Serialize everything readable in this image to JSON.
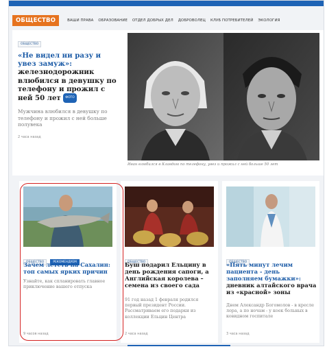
{
  "nav": {
    "section": "ОБЩЕСТВО",
    "items": [
      "ВАШИ ПРАВА",
      "ОБРАЗОВАНИЕ",
      "ОТДЕЛ ДОБРЫХ ДЕЛ",
      "ДОБРОВОЛЕЦ",
      "КЛУБ ПОТРЕБИТЕЛЕЙ",
      "ЭКОЛОГИЯ"
    ]
  },
  "hero": {
    "badge": "ОБЩЕСТВО",
    "title_quote": "«Не видел ни разу и увез замуж»:",
    "title_rest": "железнодорожник влюбился в девушку по телефону и прожил с ней 50 лет",
    "photo_tag": "ФОТО",
    "lead": "Мужчина влюбился в девушку по телефону и прожил с ней больше полувека",
    "time": "2 часа назад",
    "caption": "Иван влюбился в Клавдию по телефону, увез и прожил с ней больше 50 лет"
  },
  "cards": [
    {
      "badges": [
        "ОБЩЕСТВО",
        "РЕКОМЕНДУЕМ"
      ],
      "title_quote": "",
      "title_rest": "Зачем лететь на Сахалин: топ самых ярких причин",
      "lead": "Узнайте, как спланировать главное приключение вашего отпуска",
      "time": "9 часов назад"
    },
    {
      "badges": [
        "ОБЩЕСТВО"
      ],
      "title_quote": "",
      "title_rest": "Буш подарил Ельцину в день рождения сапоги, а Английская королева – семена из своего сада",
      "lead": "91 год назад 1 февраля родился первый президент России. Рассматриваем его подарки из коллекции Ельцин Центра",
      "time": "2 часа назад"
    },
    {
      "badges": [
        "ОБЩЕСТВО"
      ],
      "title_quote": "«Пять минут лечим пациента - день заполняем бумажки»:",
      "title_rest": "дневник алтайского врача из «красной» зоны",
      "lead": "Днем Александр Богомолов - в кресле лора, а по ночам - у коек больных в ковидном госпитале",
      "time": "3 часа назад"
    }
  ],
  "colors": {
    "accent": "#1e63b5",
    "section": "#e6731f",
    "highlight": "#d42020"
  }
}
